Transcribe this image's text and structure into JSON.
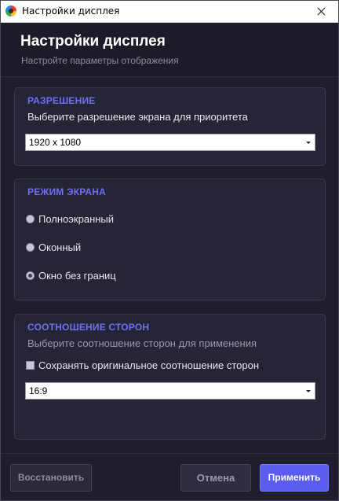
{
  "window": {
    "title": "Настройки дисплея"
  },
  "header": {
    "title": "Настройки дисплея",
    "subtitle": "Настройте параметры отображения"
  },
  "resolution": {
    "title": "РАЗРЕШЕНИЕ",
    "description": "Выберите разрешение экрана для приоритета",
    "selected": "1920 x 1080"
  },
  "screen_mode": {
    "title": "РЕЖИМ ЭКРАНА",
    "options": [
      {
        "label": "Полноэкранный",
        "checked": false
      },
      {
        "label": "Оконный",
        "checked": false
      },
      {
        "label": "Окно без границ",
        "checked": true
      }
    ]
  },
  "aspect": {
    "title": "СООТНОШЕНИЕ СТОРОН",
    "description": "Выберите соотношение сторон для применения",
    "keep_original_label": "Сохранять оригинальное соотношение сторон",
    "keep_original_checked": false,
    "selected": "16:9"
  },
  "footer": {
    "reset_label": "Восстановить",
    "cancel_label": "Отмена",
    "apply_label": "Применить"
  },
  "colors": {
    "accent": "#5b5cf0",
    "section_title": "#6e6ff5",
    "background": "#1f1e2c",
    "panel": "#262535"
  }
}
